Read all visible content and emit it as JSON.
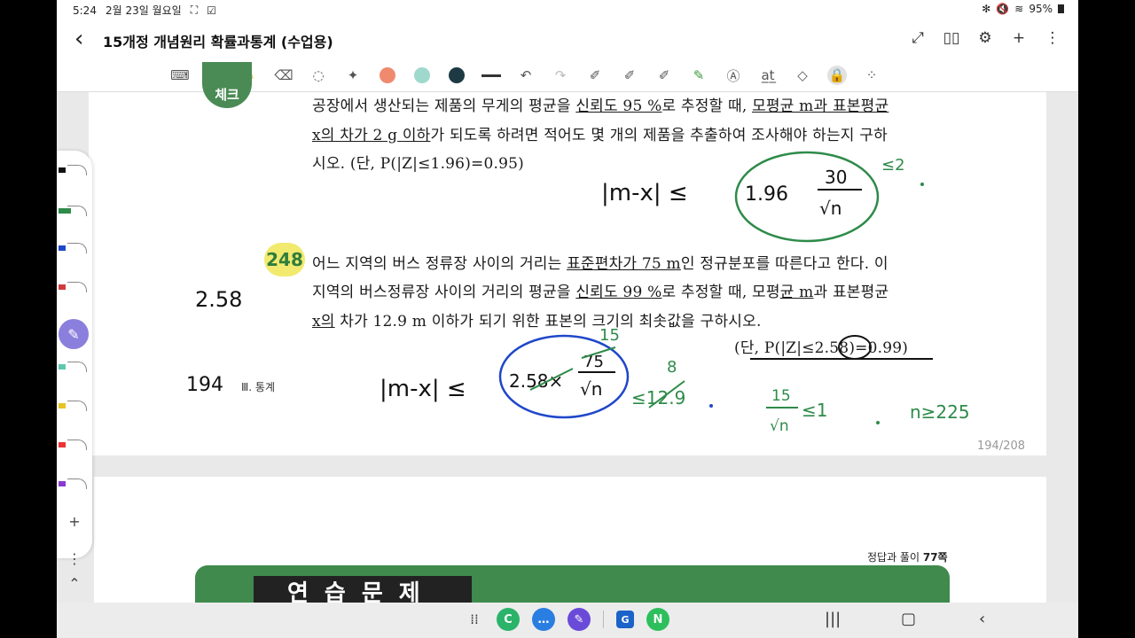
{
  "status": {
    "time": "5:24",
    "date": "2월 23일 월요일",
    "battery": "95%"
  },
  "app": {
    "title": "15개정 개념원리 확률과통계 (수업용)"
  },
  "toolbar": {
    "colors": [
      "#ef8a6f",
      "#9fd8cc",
      "#1d3a44"
    ]
  },
  "problem_prev": {
    "badge": "체크",
    "line1": [
      "공장에서 생산되는 제품의 무게의 평균을 ",
      "신뢰도 95 %",
      "로 추정할 때, ",
      "모평균 m과 표본평균"
    ],
    "line2": [
      "x의 차가 2 g 이하",
      "가 되도록 하려면 적어도 몇 개의 제품을 추출하여 조사해야 하는지 구하"
    ],
    "line3": "시오. (단, P(|Z|≤1.96)=0.95)"
  },
  "problem_248": {
    "number": "248",
    "line1": [
      "어느 지역의 버스 정류장 사이의 거리는 ",
      "표준편차가 75 m",
      "인 정규분포를 따른다고 한다. 이"
    ],
    "line2": [
      "지역의 버스정류장 사이의 거리의 평균을 ",
      "신뢰도 99 %",
      "로 추정할 때, 모평",
      "균 m",
      "과 표본평균"
    ],
    "line3": [
      "x의",
      " 차가 12.9 m 이하가 되기 위한 표본의 크기의 최솟값을 구하시오."
    ],
    "hint": "(단, P(|Z|≤2.58)=0.99)"
  },
  "handwriting": {
    "eq1_left": "|m-x| ≤",
    "eq1_coef": "1.96",
    "eq1_num": "30",
    "eq1_den": "√n",
    "eq1_right": "≤2",
    "note_left": "2.58",
    "eq2_left": "|m-x| ≤",
    "eq2_coef": "2.58×",
    "eq2_num": "75",
    "eq2_den": "√n",
    "eq2_small": "15",
    "eq2_right": "≤12.9",
    "eq2_small2": "8",
    "eq3_num": "15",
    "eq3_den": "√n",
    "eq3_right": "≤1",
    "eq3_result": "n≥225"
  },
  "footer": {
    "page_number": "194",
    "section": "Ⅲ. 통계",
    "counter": "194/208",
    "answer_ref": "정답과 풀이",
    "answer_page": "77쪽",
    "next_heading": "연습문제"
  }
}
